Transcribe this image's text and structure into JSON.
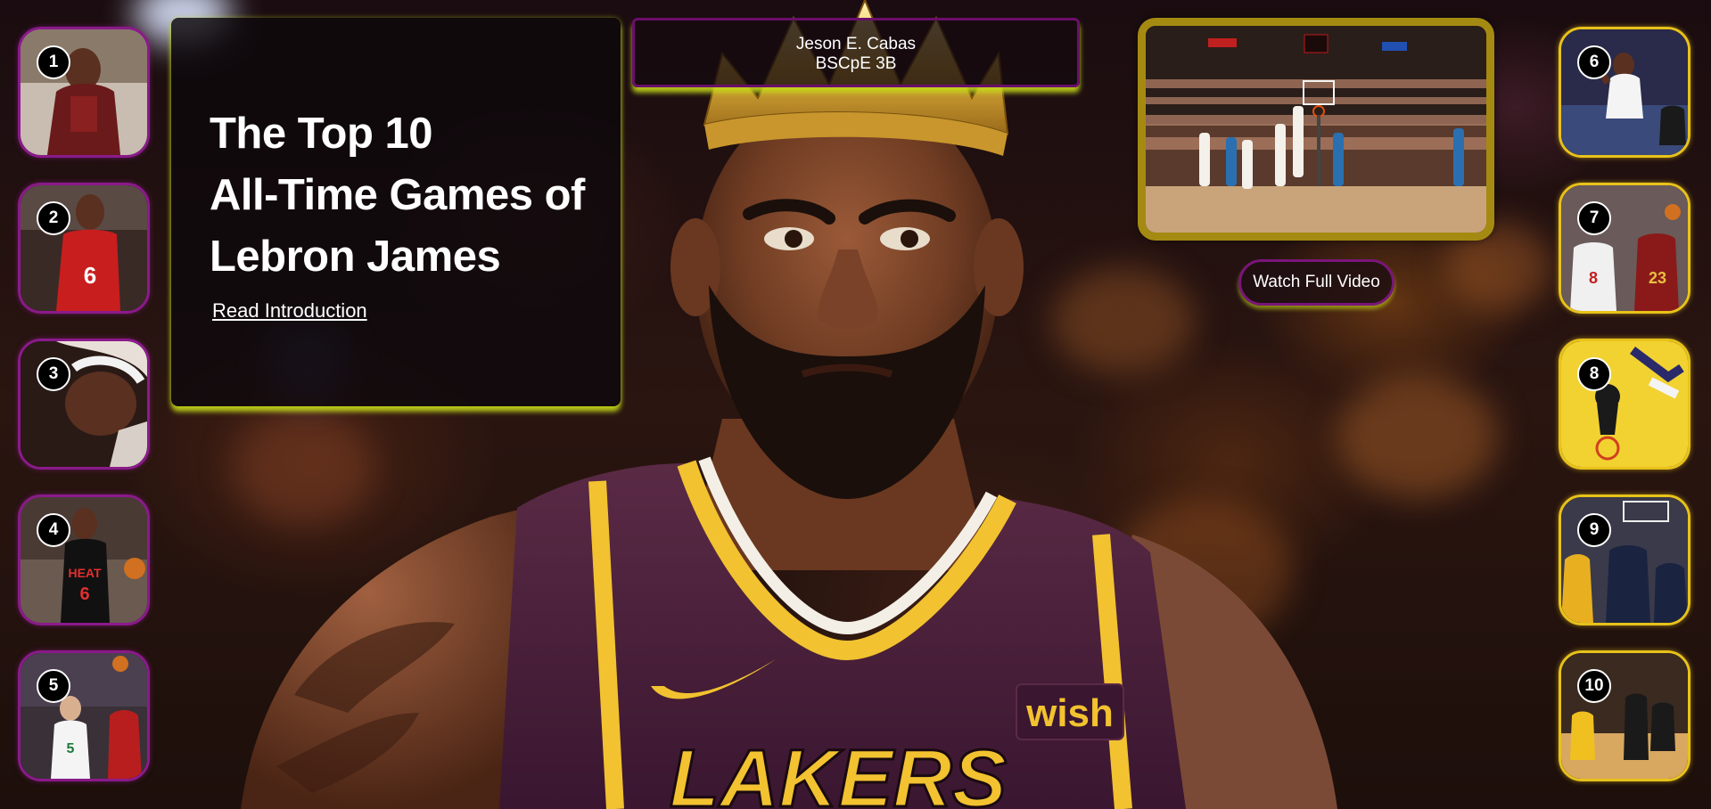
{
  "colors": {
    "left_thumb_border": "#8b1a8b",
    "right_thumb_border": "#e8c21a",
    "panel_glow": "#c3d719",
    "video_border": "#a58a12"
  },
  "intro": {
    "title_lines": [
      "The Top 10",
      "All-Time Games of",
      "Lebron James"
    ],
    "link_label": "Read Introduction"
  },
  "author": {
    "name": "Jeson E. Cabas",
    "section": "BSCpE 3B"
  },
  "video": {
    "thumbnail_icon": "video-thumbnail",
    "button_label": "Watch Full Video"
  },
  "thumbnails": {
    "left": [
      {
        "number": "1"
      },
      {
        "number": "2"
      },
      {
        "number": "3"
      },
      {
        "number": "4"
      },
      {
        "number": "5"
      }
    ],
    "right": [
      {
        "number": "6"
      },
      {
        "number": "7"
      },
      {
        "number": "8"
      },
      {
        "number": "9"
      },
      {
        "number": "10"
      }
    ]
  },
  "hero": {
    "jersey_text": "LAKERS",
    "patch_text": "wish"
  }
}
